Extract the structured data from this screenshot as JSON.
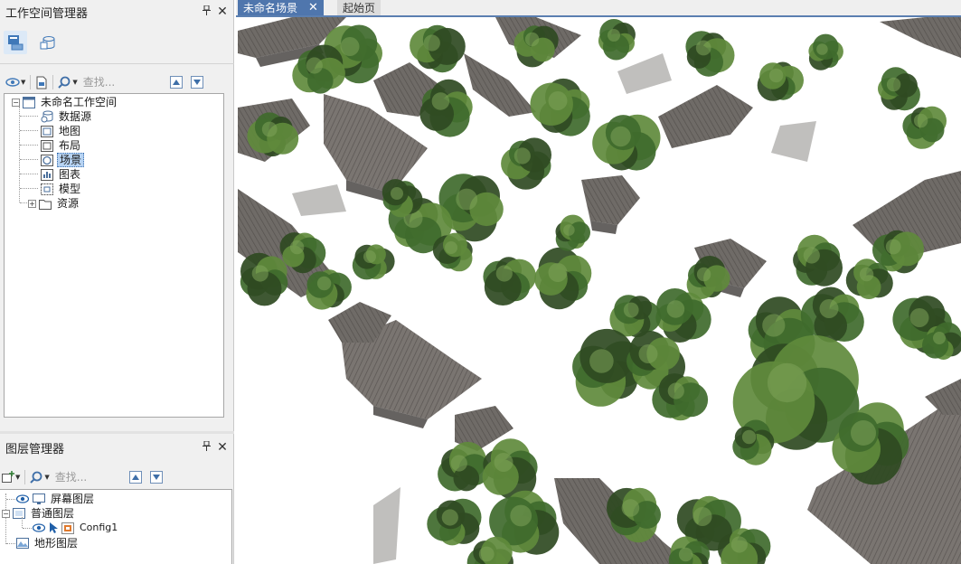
{
  "workspace_panel": {
    "title": "工作空间管理器",
    "pin_glyph": "🖈",
    "close_glyph": "✕",
    "search_placeholder": "查找...",
    "tree": {
      "root": "未命名工作空间",
      "items": [
        {
          "label": "数据源",
          "icon": "datasource-icon"
        },
        {
          "label": "地图",
          "icon": "map-icon"
        },
        {
          "label": "布局",
          "icon": "layout-icon"
        },
        {
          "label": "场景",
          "icon": "scene-icon",
          "selected": true
        },
        {
          "label": "图表",
          "icon": "chart-icon"
        },
        {
          "label": "模型",
          "icon": "model-icon"
        },
        {
          "label": "资源",
          "icon": "resource-icon",
          "expandable": true
        }
      ]
    }
  },
  "layer_panel": {
    "title": "图层管理器",
    "search_placeholder": "查找...",
    "tree": {
      "screen_layers": "屏幕图层",
      "normal_layers": "普通图层",
      "config_layer": "Config1",
      "terrain_layers": "地形图层"
    }
  },
  "tabs": [
    {
      "label": "未命名场景",
      "active": true,
      "close_glyph": "✕"
    },
    {
      "label": "起始页",
      "active": false
    }
  ],
  "colors": {
    "tab_active": "#4f76ad",
    "selection": "#b7d3f2",
    "roof": "#6e6a66",
    "tree_dark": "#2f4a22",
    "tree_light": "#5f8a3c"
  }
}
